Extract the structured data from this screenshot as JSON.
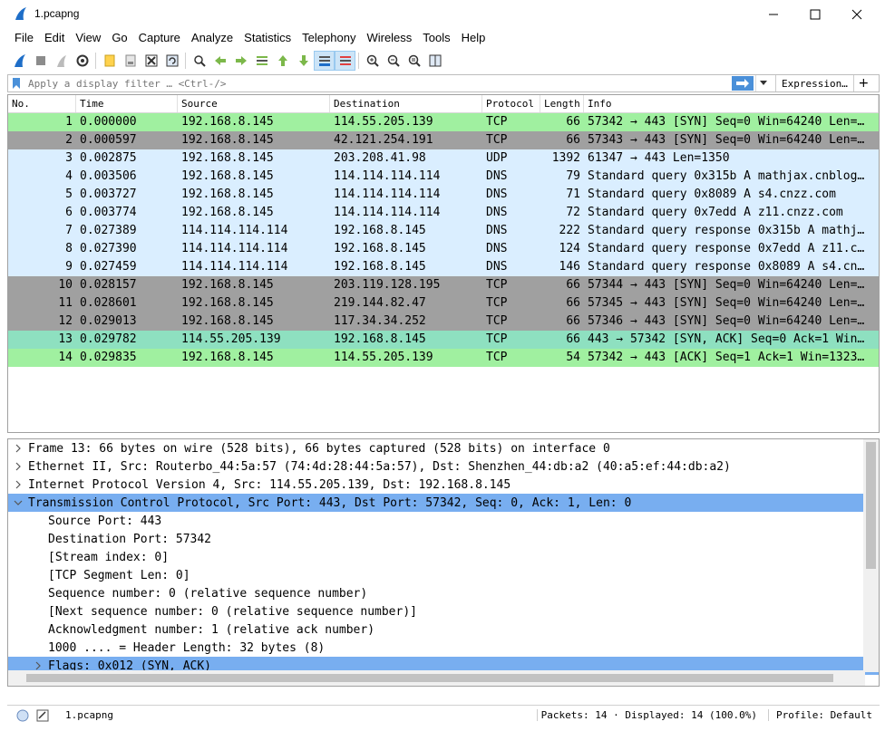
{
  "window": {
    "title": "1.pcapng"
  },
  "menu": [
    "File",
    "Edit",
    "View",
    "Go",
    "Capture",
    "Analyze",
    "Statistics",
    "Telephony",
    "Wireless",
    "Tools",
    "Help"
  ],
  "filter": {
    "placeholder": "Apply a display filter … <Ctrl-/>",
    "expression_label": "Expression…",
    "plus_label": "+"
  },
  "columns": [
    "No.",
    "Time",
    "Source",
    "Destination",
    "Protocol",
    "Length",
    "Info"
  ],
  "packets": [
    {
      "no": "1",
      "time": "0.000000",
      "src": "192.168.8.145",
      "dst": "114.55.205.139",
      "proto": "TCP",
      "len": "66",
      "info": "57342 → 443 [SYN] Seq=0 Win=64240 Len=…",
      "bg": "#a0f0a0"
    },
    {
      "no": "2",
      "time": "0.000597",
      "src": "192.168.8.145",
      "dst": "42.121.254.191",
      "proto": "TCP",
      "len": "66",
      "info": "57343 → 443 [SYN] Seq=0 Win=64240 Len=…",
      "bg": "#a0a0a0"
    },
    {
      "no": "3",
      "time": "0.002875",
      "src": "192.168.8.145",
      "dst": "203.208.41.98",
      "proto": "UDP",
      "len": "1392",
      "info": "61347 → 443 Len=1350",
      "bg": "#daeeff"
    },
    {
      "no": "4",
      "time": "0.003506",
      "src": "192.168.8.145",
      "dst": "114.114.114.114",
      "proto": "DNS",
      "len": "79",
      "info": "Standard query 0x315b A mathjax.cnblog…",
      "bg": "#daeeff"
    },
    {
      "no": "5",
      "time": "0.003727",
      "src": "192.168.8.145",
      "dst": "114.114.114.114",
      "proto": "DNS",
      "len": "71",
      "info": "Standard query 0x8089 A s4.cnzz.com",
      "bg": "#daeeff"
    },
    {
      "no": "6",
      "time": "0.003774",
      "src": "192.168.8.145",
      "dst": "114.114.114.114",
      "proto": "DNS",
      "len": "72",
      "info": "Standard query 0x7edd A z11.cnzz.com",
      "bg": "#daeeff"
    },
    {
      "no": "7",
      "time": "0.027389",
      "src": "114.114.114.114",
      "dst": "192.168.8.145",
      "proto": "DNS",
      "len": "222",
      "info": "Standard query response 0x315b A mathj…",
      "bg": "#daeeff"
    },
    {
      "no": "8",
      "time": "0.027390",
      "src": "114.114.114.114",
      "dst": "192.168.8.145",
      "proto": "DNS",
      "len": "124",
      "info": "Standard query response 0x7edd A z11.c…",
      "bg": "#daeeff"
    },
    {
      "no": "9",
      "time": "0.027459",
      "src": "114.114.114.114",
      "dst": "192.168.8.145",
      "proto": "DNS",
      "len": "146",
      "info": "Standard query response 0x8089 A s4.cn…",
      "bg": "#daeeff"
    },
    {
      "no": "10",
      "time": "0.028157",
      "src": "192.168.8.145",
      "dst": "203.119.128.195",
      "proto": "TCP",
      "len": "66",
      "info": "57344 → 443 [SYN] Seq=0 Win=64240 Len=…",
      "bg": "#a0a0a0"
    },
    {
      "no": "11",
      "time": "0.028601",
      "src": "192.168.8.145",
      "dst": "219.144.82.47",
      "proto": "TCP",
      "len": "66",
      "info": "57345 → 443 [SYN] Seq=0 Win=64240 Len=…",
      "bg": "#a0a0a0"
    },
    {
      "no": "12",
      "time": "0.029013",
      "src": "192.168.8.145",
      "dst": "117.34.34.252",
      "proto": "TCP",
      "len": "66",
      "info": "57346 → 443 [SYN] Seq=0 Win=64240 Len=…",
      "bg": "#a0a0a0"
    },
    {
      "no": "13",
      "time": "0.029782",
      "src": "114.55.205.139",
      "dst": "192.168.8.145",
      "proto": "TCP",
      "len": "66",
      "info": "443 → 57342 [SYN, ACK] Seq=0 Ack=1 Win…",
      "bg": "#8ee0c0"
    },
    {
      "no": "14",
      "time": "0.029835",
      "src": "192.168.8.145",
      "dst": "114.55.205.139",
      "proto": "TCP",
      "len": "54",
      "info": "57342 → 443 [ACK] Seq=1 Ack=1 Win=1323…",
      "bg": "#a0f0a0"
    }
  ],
  "details": [
    {
      "text": "Frame 13: 66 bytes on wire (528 bits), 66 bytes captured (528 bits) on interface 0",
      "arrow": "right",
      "level": 0,
      "selected": false
    },
    {
      "text": "Ethernet II, Src: Routerbo_44:5a:57 (74:4d:28:44:5a:57), Dst: Shenzhen_44:db:a2 (40:a5:ef:44:db:a2)",
      "arrow": "right",
      "level": 0,
      "selected": false
    },
    {
      "text": "Internet Protocol Version 4, Src: 114.55.205.139, Dst: 192.168.8.145",
      "arrow": "right",
      "level": 0,
      "selected": false
    },
    {
      "text": "Transmission Control Protocol, Src Port: 443, Dst Port: 57342, Seq: 0, Ack: 1, Len: 0",
      "arrow": "down",
      "level": 0,
      "selected": true
    },
    {
      "text": "Source Port: 443",
      "arrow": "none",
      "level": 1,
      "selected": false
    },
    {
      "text": "Destination Port: 57342",
      "arrow": "none",
      "level": 1,
      "selected": false
    },
    {
      "text": "[Stream index: 0]",
      "arrow": "none",
      "level": 1,
      "selected": false
    },
    {
      "text": "[TCP Segment Len: 0]",
      "arrow": "none",
      "level": 1,
      "selected": false
    },
    {
      "text": "Sequence number: 0    (relative sequence number)",
      "arrow": "none",
      "level": 1,
      "selected": false
    },
    {
      "text": "[Next sequence number: 0    (relative sequence number)]",
      "arrow": "none",
      "level": 1,
      "selected": false
    },
    {
      "text": "Acknowledgment number: 1    (relative ack number)",
      "arrow": "none",
      "level": 1,
      "selected": false
    },
    {
      "text": "1000 .... = Header Length: 32 bytes (8)",
      "arrow": "none",
      "level": 1,
      "selected": false
    },
    {
      "text": "Flags: 0x012 (SYN, ACK)",
      "arrow": "right",
      "level": 1,
      "selected": true
    }
  ],
  "status": {
    "file": "1.pcapng",
    "packets": "Packets: 14 · Displayed: 14 (100.0%)",
    "profile": "Profile: Default"
  },
  "colors": {
    "accent": "#78aef0",
    "tcp_syn": "#a0f0a0",
    "tcp_bad": "#a0a0a0",
    "udp": "#daeeff",
    "synack": "#8ee0c0"
  }
}
